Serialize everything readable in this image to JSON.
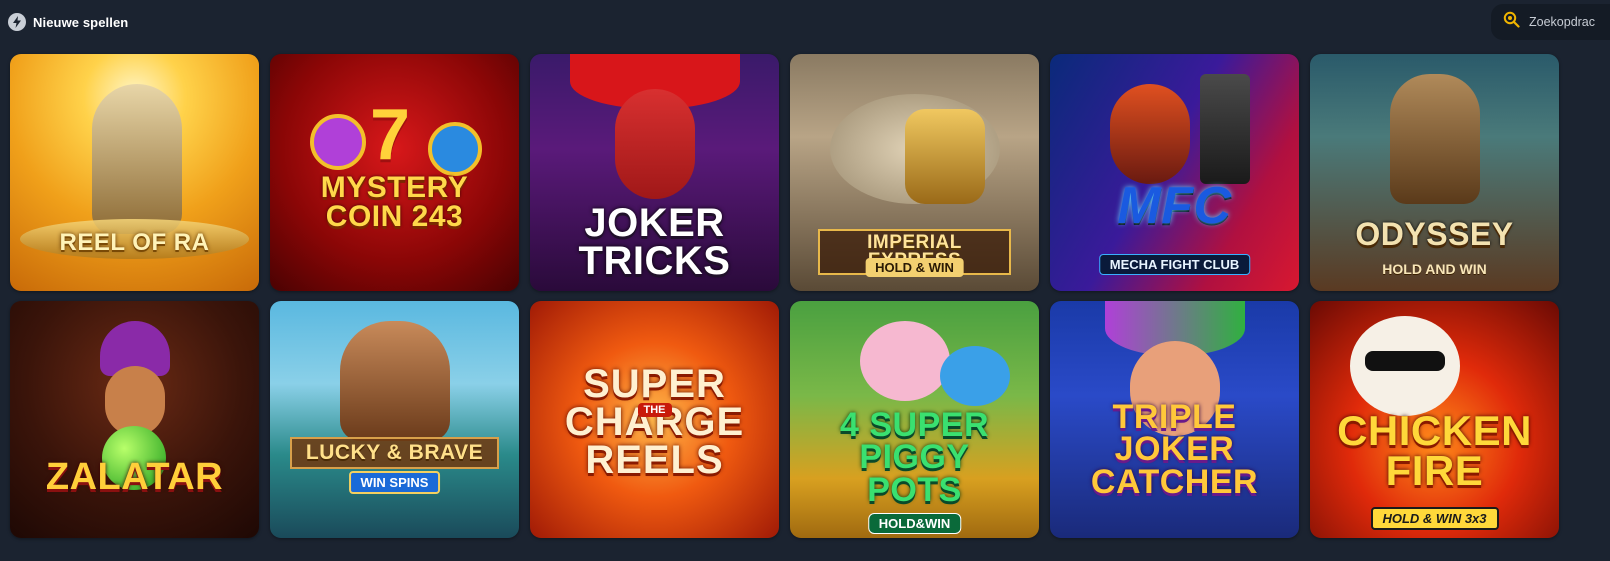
{
  "section": {
    "title": "Nieuwe spellen",
    "icon": "lightning-icon"
  },
  "search": {
    "placeholder": "Zoekopdrac",
    "icon": "search-icon"
  },
  "games": [
    {
      "title": "REEL OF RA",
      "subtitle": ""
    },
    {
      "title": "MYSTERY\nCOIN 243",
      "subtitle": ""
    },
    {
      "title": "JOKER\nTRICKS",
      "subtitle": ""
    },
    {
      "title": "IMPERIAL EXPRESS",
      "subtitle": "HOLD & WIN"
    },
    {
      "title": "MFC",
      "subtitle": "MECHA FIGHT CLUB"
    },
    {
      "title": "ODYSSEY",
      "subtitle": "HOLD AND WIN"
    },
    {
      "title": "ZALATAR",
      "subtitle": ""
    },
    {
      "title": "LUCKY & BRAVE",
      "subtitle": "WIN SPINS"
    },
    {
      "title": "SUPER\nCHARGE\nREELS",
      "subtitle": "THE"
    },
    {
      "title": "4 SUPER\nPIGGY\nPOTS",
      "subtitle": "HOLD&WIN"
    },
    {
      "title": "TRIPLE\nJOKER\nCATCHER",
      "subtitle": ""
    },
    {
      "title": "CHICKEN\nFIRE",
      "subtitle": "HOLD & WIN 3x3"
    }
  ],
  "colors": {
    "background": "#1b2330",
    "search_bg": "#141b25",
    "search_icon": "#f0b400"
  }
}
